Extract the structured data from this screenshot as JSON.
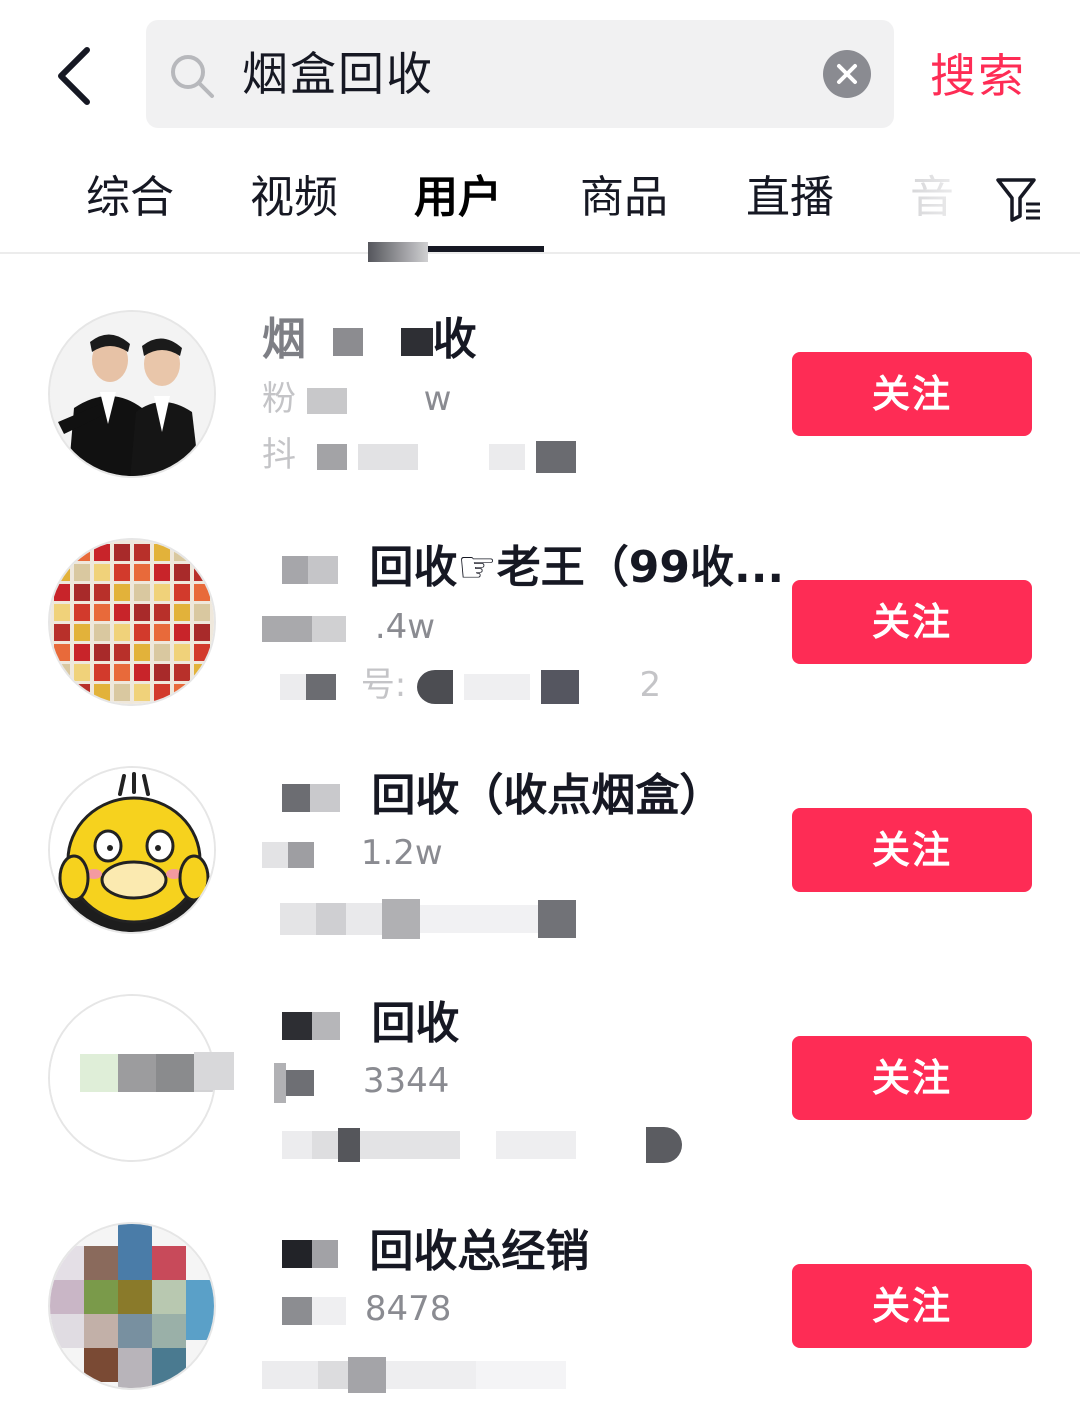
{
  "search": {
    "query": "烟盒回收",
    "submit_label": "搜索"
  },
  "tabs": [
    {
      "label": "综合"
    },
    {
      "label": "视频"
    },
    {
      "label": "用户"
    },
    {
      "label": "商品"
    },
    {
      "label": "直播"
    },
    {
      "label": "音"
    }
  ],
  "active_tab": "用户",
  "results": [
    {
      "name_visible": "收",
      "name_prefix_visible": "烟",
      "meta1_visible": "w",
      "meta1_prefix": "粉",
      "meta2_prefix": "抖",
      "follow_label": "关注"
    },
    {
      "name_visible": "回收☞老王（99收...",
      "meta1_visible": ".4w",
      "meta2_visible": "号:",
      "meta2_suffix": "2",
      "follow_label": "关注"
    },
    {
      "name_visible": "回收（收点烟盒）",
      "meta1_visible": "1.2w",
      "follow_label": "关注"
    },
    {
      "name_visible": "回收",
      "meta1_visible": "3344",
      "follow_label": "关注"
    },
    {
      "name_visible": "回收总经销",
      "meta1_visible": "8478",
      "follow_label": "关注"
    }
  ],
  "colors": {
    "accent": "#fe2c55",
    "text": "#161823",
    "secondary": "#8a8b91",
    "search_bg": "#f1f1f2"
  }
}
